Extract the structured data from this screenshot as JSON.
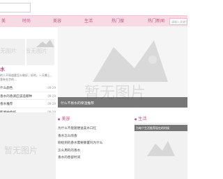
{
  "nav": {
    "items": [
      "美",
      "时尚",
      "美容",
      "生活",
      "热门搜",
      "热门新闻"
    ],
    "search_placeholder": "请输入关键字搜索"
  },
  "thumbs": {
    "watermark": "暂无图片"
  },
  "sidebar": {
    "title": "水",
    "intro": "的人不知道要怎么做好，好的。一天晚上，我有名字的…",
    "items": [
      {
        "title": "什么颜色",
        "date": "09-29"
      },
      {
        "title": "香水的香调应该选哪种",
        "date": "09-29"
      },
      {
        "title": "香水推荐",
        "date": "09-29"
      },
      {
        "title": "能闻中会好",
        "date": "09-29"
      },
      {
        "title": "能闻中会调的香味",
        "date": "09-29"
      }
    ]
  },
  "hero": {
    "watermark": "暂无图片",
    "caption": "什么不易水的保湿推荐"
  },
  "beauty": {
    "title": "美容",
    "items": [
      "为什么不能随便送美水口红",
      "香水怎么喷香",
      "刚给到的香水需要静置吗为什么",
      "怎么用的的香水",
      "香水的香留时间"
    ]
  },
  "life": {
    "title": "生活",
    "caption": "为每个生活推荐现在的时候"
  }
}
